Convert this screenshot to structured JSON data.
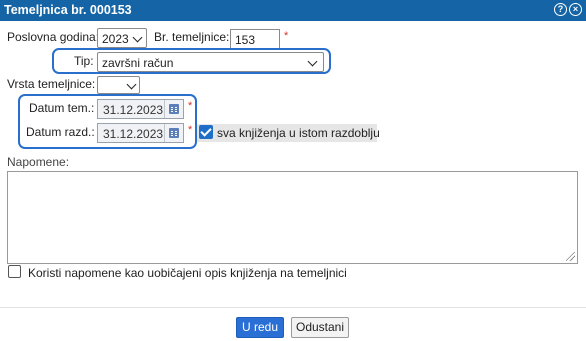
{
  "window": {
    "title": "Temeljnica br. 000153",
    "help_icon": "help-icon",
    "close_icon": "close-icon"
  },
  "form": {
    "year_label": "Poslovna godina:",
    "year_value": "2023",
    "number_label": "Br. temeljnice:",
    "number_value": "153",
    "type_label": "Tip:",
    "type_value": "završni račun",
    "kind_label": "Vrsta temeljnice:",
    "kind_value": "",
    "date_label": "Datum tem.:",
    "date_value": "31.12.2023",
    "due_date_label": "Datum razd.:",
    "due_date_value": "31.12.2023",
    "same_period_label": "sva knjiženja u istom razdoblju",
    "same_period_checked": true,
    "notes_label": "Napomene:",
    "notes_value": "",
    "use_notes_label": "Koristi napomene kao uobičajeni opis knjiženja na temeljnici",
    "use_notes_checked": false,
    "required_mark": "*"
  },
  "buttons": {
    "ok": "U redu",
    "cancel": "Odustani"
  },
  "colors": {
    "titlebar": "#1565a6",
    "highlight": "#2a6fcc",
    "primary_button": "#2a6fd6",
    "required": "#d0342c"
  }
}
